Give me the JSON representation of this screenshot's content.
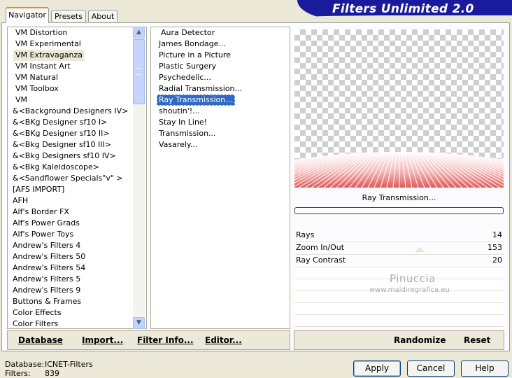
{
  "tabs": [
    "Navigator",
    "Presets",
    "About"
  ],
  "banner_title": "Filters Unlimited 2.0",
  "categories": [
    "VM Distortion",
    "VM Experimental",
    "VM Extravaganza",
    "VM Instant Art",
    "VM Natural",
    "VM Toolbox",
    "VM",
    "&<Background Designers IV>",
    "&<BKg Designer sf10 I>",
    "&<BKg Designer sf10 II>",
    "&<Bkg Designer sf10 III>",
    "&<Bkg Designers sf10 IV>",
    "&<Bkg Kaleidoscope>",
    "&<Sandflower Specials\"v\" >",
    "[AFS IMPORT]",
    "AFH",
    "Alf's Border FX",
    "Alf's Power Grads",
    "Alf's Power Toys",
    "Andrew's Filters 4",
    "Andrew's Filters 50",
    "Andrew's Filters 54",
    "Andrew's Filters 5",
    "Andrew's Filters 9",
    "Buttons & Frames",
    "Color Effects",
    "Color Filters"
  ],
  "filters": [
    "Aura Detector",
    "James Bondage...",
    "Picture in a Picture",
    "Plastic Surgery",
    "Psychedelic...",
    "Radial Transmission...",
    "Ray Transmission...",
    "shoutin'!...",
    "Stay In Line!",
    "Transmission...",
    "Vasarely..."
  ],
  "selected_filter_label": "Ray Transmission...",
  "progress": 0,
  "params": [
    {
      "label": "Rays",
      "value": "14"
    },
    {
      "label": "Zoom In/Out",
      "value": "153"
    },
    {
      "label": "Ray Contrast",
      "value": "20"
    }
  ],
  "watermark": {
    "line1": "Pinuccia",
    "line2": "www.maidiregrafica.eu"
  },
  "left_buttons": {
    "database": "Database",
    "import": "Import...",
    "filter_info": "Filter Info...",
    "editor": "Editor..."
  },
  "right_buttons": {
    "randomize": "Randomize",
    "reset": "Reset"
  },
  "status": {
    "database_label": "Database:",
    "database_value": "ICNET-Filters",
    "filters_label": "Filters:",
    "filters_value": "839"
  },
  "dialog_buttons": {
    "apply": "Apply",
    "cancel": "Cancel",
    "help": "Help"
  },
  "colors": {
    "banner": "#1a1a9c",
    "selection": "#316ac5",
    "ray_color": "#e05a5a"
  }
}
